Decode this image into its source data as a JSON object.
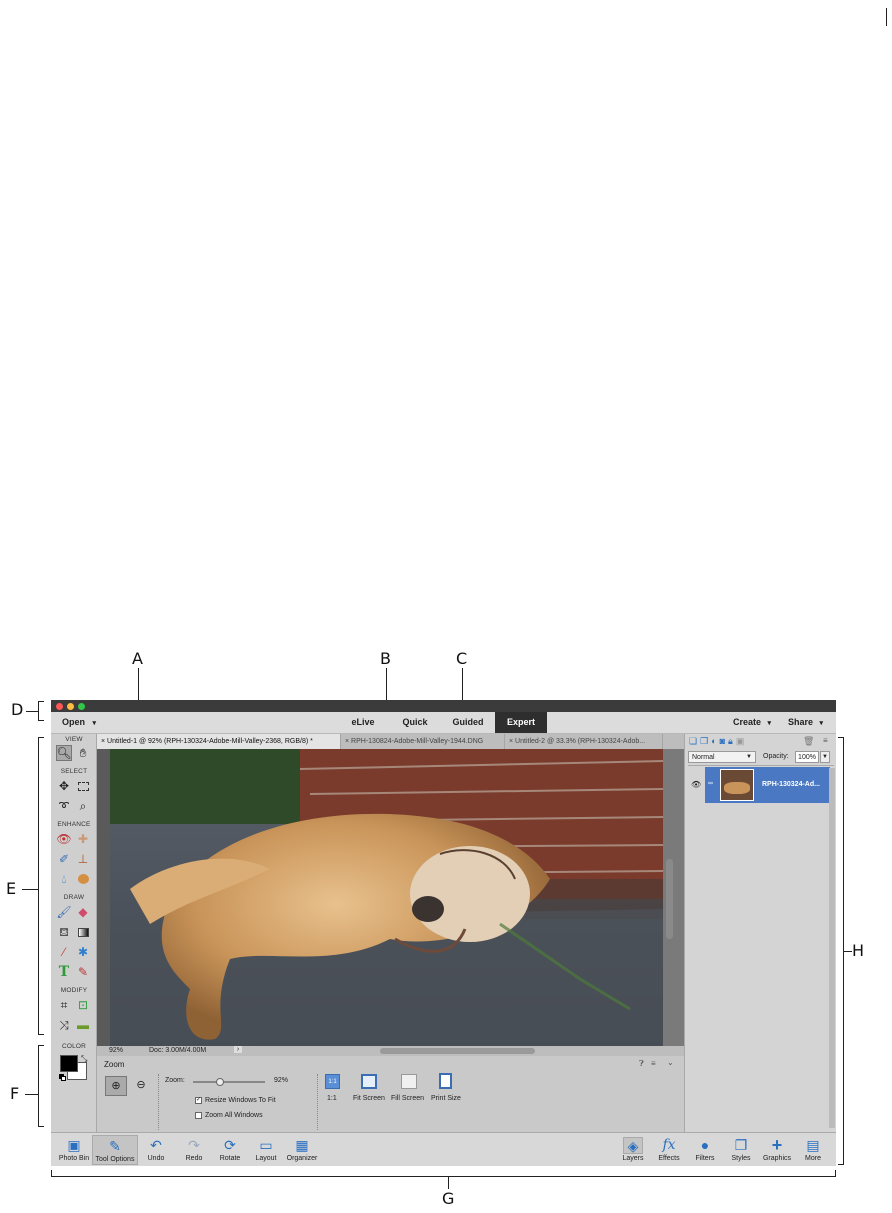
{
  "callouts": {
    "a": "A",
    "b": "B",
    "c": "C",
    "d": "D",
    "e": "E",
    "f": "F",
    "g": "G",
    "h": "H"
  },
  "menubar": {
    "open": "Open",
    "open_arrow": "▾",
    "modes": [
      "eLive",
      "Quick",
      "Guided",
      "Expert"
    ],
    "create": "Create",
    "create_arrow": "▾",
    "share": "Share",
    "share_arrow": "▾"
  },
  "toolbox": {
    "sections": {
      "view": "VIEW",
      "select": "SELECT",
      "enhance": "ENHANCE",
      "draw": "DRAW",
      "modify": "MODIFY",
      "color": "COLOR"
    }
  },
  "doc_tabs": [
    {
      "close": "×",
      "label": "Untitled-1 @ 92% (RPH-130324-Adobe-Mill-Valley-2368, RGB/8) *"
    },
    {
      "close": "×",
      "label": "RPH-130824-Adobe-Mill-Valley-1944.DNG"
    },
    {
      "close": "×",
      "label": "Untitled-2 @ 33.3% (RPH-130324-Adob..."
    }
  ],
  "status": {
    "zoom": "92%",
    "doc": "Doc: 3.00M/4.00M",
    "arrow": "›"
  },
  "tool_options": {
    "title": "Zoom",
    "zoom_label": "Zoom:",
    "zoom_value": "92%",
    "zoom_fraction": 0.38,
    "resize_windows": "Resize Windows To Fit",
    "zoom_all": "Zoom All Windows",
    "checkmark": "✓",
    "view_buttons": [
      {
        "icon": "1:1",
        "label": "1:1"
      },
      {
        "label": "Fit Screen"
      },
      {
        "label": "Fill Screen"
      },
      {
        "label": "Print Size"
      }
    ]
  },
  "layers_panel": {
    "blend_mode": "Normal",
    "opacity_label": "Opacity:",
    "opacity_value": "100%",
    "layer_name": "RPH-130324-Ad..."
  },
  "taskbar": {
    "left": [
      {
        "label": "Photo Bin",
        "icon": "▣"
      },
      {
        "label": "Tool Options",
        "icon": "✎"
      },
      {
        "label": "Undo",
        "icon": "↶"
      },
      {
        "label": "Redo",
        "icon": "↷"
      },
      {
        "label": "Rotate",
        "icon": "⟳"
      },
      {
        "label": "Layout",
        "icon": "▭"
      },
      {
        "label": "Organizer",
        "icon": "▦"
      }
    ],
    "right": [
      {
        "label": "Layers",
        "icon": "◈"
      },
      {
        "label": "Effects",
        "icon": "fx"
      },
      {
        "label": "Filters",
        "icon": "●"
      },
      {
        "label": "Styles",
        "icon": "❐"
      },
      {
        "label": "Graphics",
        "icon": "+"
      },
      {
        "label": "More",
        "icon": "▤"
      }
    ]
  },
  "colors": {
    "accent": "#4a78c2",
    "titlebar": "#3b3b3b",
    "active_mode": "#2e2e2e"
  }
}
